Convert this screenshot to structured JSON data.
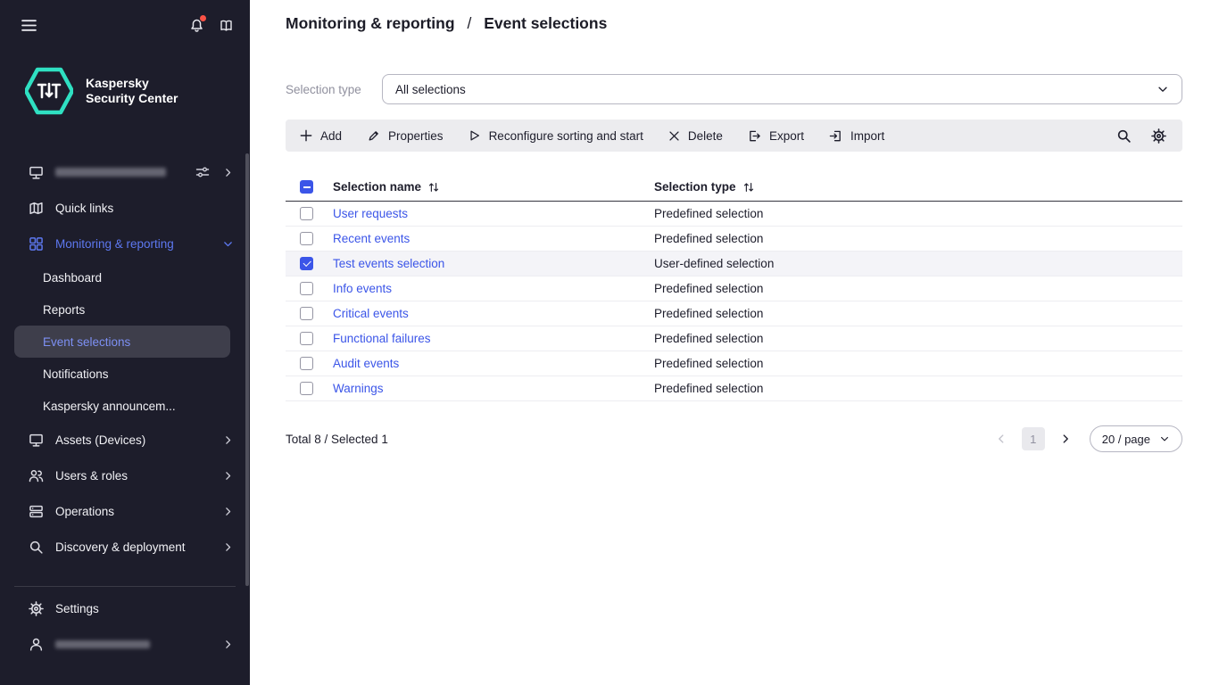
{
  "header": {
    "breadcrumb": [
      "Monitoring & reporting",
      "Event selections"
    ],
    "separator": "/"
  },
  "sidebar": {
    "brand_line1": "Kaspersky",
    "brand_line2": "Security Center",
    "quick_links": "Quick links",
    "monitoring": "Monitoring & reporting",
    "monitoring_children": [
      "Dashboard",
      "Reports",
      "Event selections",
      "Notifications",
      "Kaspersky announcem..."
    ],
    "assets": "Assets (Devices)",
    "users_roles": "Users & roles",
    "operations": "Operations",
    "discovery": "Discovery & deployment",
    "settings": "Settings"
  },
  "filter": {
    "label": "Selection type",
    "value": "All selections"
  },
  "toolbar": {
    "add": "Add",
    "properties": "Properties",
    "reconfigure": "Reconfigure sorting and start",
    "delete": "Delete",
    "export": "Export",
    "import": "Import"
  },
  "table": {
    "header_indeterminate": true,
    "columns": [
      "Selection name",
      "Selection type"
    ],
    "rows": [
      {
        "name": "User requests",
        "type": "Predefined selection",
        "checked": false
      },
      {
        "name": "Recent events",
        "type": "Predefined selection",
        "checked": false
      },
      {
        "name": "Test events selection",
        "type": "User-defined selection",
        "checked": true
      },
      {
        "name": "Info events",
        "type": "Predefined selection",
        "checked": false
      },
      {
        "name": "Critical events",
        "type": "Predefined selection",
        "checked": false
      },
      {
        "name": "Functional failures",
        "type": "Predefined selection",
        "checked": false
      },
      {
        "name": "Audit events",
        "type": "Predefined selection",
        "checked": false
      },
      {
        "name": "Warnings",
        "type": "Predefined selection",
        "checked": false
      }
    ]
  },
  "footer": {
    "summary": "Total 8 / Selected 1",
    "page": "1",
    "page_size": "20 / page"
  },
  "colors": {
    "sidebar_bg": "#1d1d2b",
    "accent_blue": "#3b55e8",
    "brand_teal": "#2fe0c2",
    "selected_row_bg": "#f4f4f8",
    "toolbar_bg": "#ececef",
    "notification_dot": "#fb5246"
  }
}
